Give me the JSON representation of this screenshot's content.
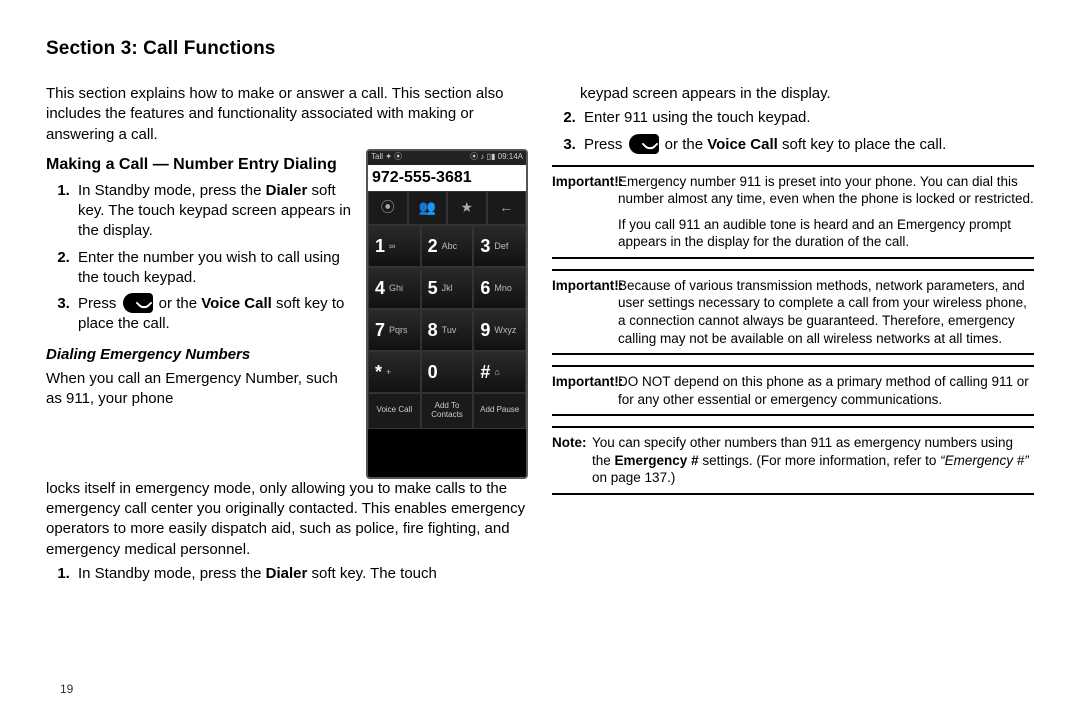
{
  "section_title": "Section 3: Call Functions",
  "page_number": "19",
  "left": {
    "intro": "This section explains how to make or answer a call. This section also includes the features and functionality associated with making or answering a call.",
    "heading_making": "Making a Call — Number Entry Dialing",
    "step1_a": "In Standby mode, press the ",
    "step1_dialer": "Dialer",
    "step1_b": " soft key. The touch keypad screen appears in the display.",
    "step2": "Enter the number you wish to call using the touch keypad.",
    "step3_a": "Press ",
    "step3_b": " or the ",
    "step3_vc": "Voice Call",
    "step3_c": " soft key to place the call.",
    "heading_emerg": "Dialing Emergency Numbers",
    "emerg_para1": "When you call an Emergency Number, such as 911, your phone",
    "emerg_para2": "locks itself in emergency mode, only allowing you to make calls to the emergency call center you originally contacted. This enables emergency operators to more easily dispatch aid, such as police, fire fighting, and emergency medical personnel.",
    "estep1_a": "In Standby mode, press the ",
    "estep1_dialer": "Dialer",
    "estep1_b": " soft key. The touch"
  },
  "right": {
    "cont": "keypad screen appears in the display.",
    "step2": "Enter 911 using the touch keypad.",
    "step3_a": "Press ",
    "step3_b": " or the ",
    "step3_vc": "Voice Call",
    "step3_c": " soft key to place the call.",
    "imp1_label": "Important!:",
    "imp1_a": "Emergency number 911 is preset into your phone. You can dial this number almost any time, even when the phone is locked or restricted.",
    "imp1_b": "If you call 911 an audible tone is heard and an Emergency prompt appears in the display for the duration of the call.",
    "imp2_label": "Important!:",
    "imp2": "Because of various transmission methods, network parameters, and user settings necessary to complete a call from your wireless phone, a connection cannot always be guaranteed. Therefore, emergency calling may not be available on all wireless networks at all times.",
    "imp3_label": "Important!:",
    "imp3": "DO NOT depend on this phone as a primary method of calling 911 or for any other essential or emergency communications.",
    "note_label": "Note:",
    "note_a": "You can specify other numbers than 911 as emergency numbers using the ",
    "note_em": "Emergency #",
    "note_b": " settings. (For more information, refer to ",
    "note_ref": "“Emergency #”",
    "note_c": " on page 137.)"
  },
  "phone": {
    "status_left": "Tall  ✦ ⦿",
    "status_right": "⦿ ♪ ▯▮ 09:14A",
    "dialed": "972-555-3681",
    "quick": [
      "⦿",
      "👥",
      "★",
      "←"
    ],
    "keys": [
      {
        "d": "1",
        "l": "∞"
      },
      {
        "d": "2",
        "l": "Abc"
      },
      {
        "d": "3",
        "l": "Def"
      },
      {
        "d": "4",
        "l": "Ghi"
      },
      {
        "d": "5",
        "l": "Jkl"
      },
      {
        "d": "6",
        "l": "Mno"
      },
      {
        "d": "7",
        "l": "Pqrs"
      },
      {
        "d": "8",
        "l": "Tuv"
      },
      {
        "d": "9",
        "l": "Wxyz"
      },
      {
        "d": "*",
        "l": "+"
      },
      {
        "d": "0",
        "l": ""
      },
      {
        "d": "#",
        "l": "⌂"
      }
    ],
    "soft": [
      "Voice Call",
      "Add To\nContacts",
      "Add Pause"
    ]
  }
}
